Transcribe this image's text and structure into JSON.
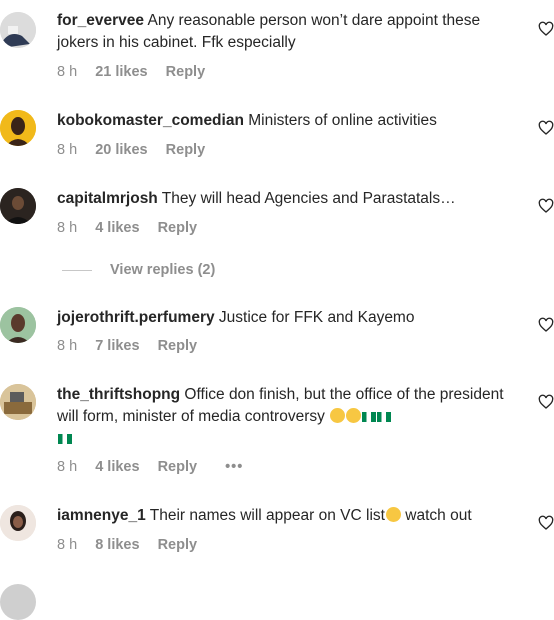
{
  "comments": [
    {
      "username": "for_evervee",
      "text": " Any reasonable person won’t dare appoint these jokers in his cabinet. Ffk especially",
      "time": "8 h",
      "likes": "21 likes",
      "reply": "Reply"
    },
    {
      "username": "kobokomaster_comedian",
      "text": " Ministers of online activities",
      "time": "8 h",
      "likes": "20 likes",
      "reply": "Reply"
    },
    {
      "username": "capitalmrjosh",
      "text": " They will head Agencies and Parastatals…",
      "time": "8 h",
      "likes": "4 likes",
      "reply": "Reply",
      "view_replies": "View replies (2)"
    },
    {
      "username": "jojerothrift.perfumery",
      "text": " Justice for FFK and Kayemo",
      "time": "8 h",
      "likes": "7 likes",
      "reply": "Reply"
    },
    {
      "username": "the_thriftshopng",
      "text": " Office don finish, but the office of the president will form, minister of media controversy ",
      "time": "8 h",
      "likes": "4 likes",
      "reply": "Reply",
      "more": "•••"
    },
    {
      "username": "iamnenye_1",
      "text": " Their names will appear on VC list",
      "text_after_emoji": " watch out",
      "time": "8 h",
      "likes": "8 likes",
      "reply": "Reply"
    }
  ],
  "icons": {
    "like": "heart-outline-icon",
    "more": "more-options-icon"
  },
  "colors": {
    "text": "#262626",
    "secondary": "#8e8e8e"
  }
}
